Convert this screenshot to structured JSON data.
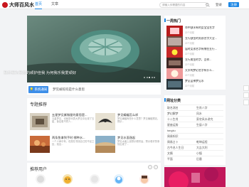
{
  "header": {
    "logo_text": "大师百风水",
    "nav": [
      {
        "label": "首页"
      },
      {
        "label": "文章"
      }
    ],
    "search_placeholder": "请输入你需要的内容",
    "login_link": "登录",
    "register_button": "注册"
  },
  "banner": {
    "caption": "我乐我为我爱的顽护佳我 为何我乐我爱顽好"
  },
  "notice": {
    "tag": "💡 系统通知",
    "text": "梦见被蛇咬是什么意思"
  },
  "recommended": {
    "title": "专题推荐",
    "items": [
      {
        "title": "五星梦见紫微星的意思是...",
        "desc": "五星梦见，也就是代表大梦见中出现了五星，象征着不同人..."
      },
      {
        "title": "梦见蝙蝠怎么样",
        "desc": "梦见蝙蝠有些什么意思？梦见蝙蝠预兆，预示..."
      },
      {
        "title": "两条鱼拿到手时 哪种水...",
        "desc": "一个人命中有，但是在寻找自己的不足之处，找出..."
      },
      {
        "title": "梦见水面涨起",
        "desc": "梦见水面上涨预示着财运，预示着好的事情出现了..."
      }
    ]
  },
  "users": {
    "title": "推荐用户",
    "prev_icon": "chevron-left",
    "next_icon": "chevron-right"
  },
  "hot": {
    "title": "一周热门",
    "items": [
      {
        "title": "命中缺水有的女宝宝名字",
        "meta": "22个月前"
      },
      {
        "title": "五行缺金的男孩名字大全...",
        "meta": "22个月前"
      },
      {
        "title": "届时女孩名字有哪些五行...",
        "meta": "22个月前"
      },
      {
        "title": "五行属金的字，吉祥...",
        "meta": "22个月前"
      },
      {
        "title": "太学的梦幻名字有什么...",
        "meta": "22个月前"
      },
      {
        "title": "梦见蓝神梦见水",
        "meta": "22个月前"
      }
    ]
  },
  "categories": {
    "title": "网址分类",
    "items": [
      "取名测名",
      "生肖八字",
      "梦幻解梦",
      "风水",
      "十二生肖",
      "家宅风水讲究",
      "星座运势",
      "生辰八字",
      "tangku",
      "",
      "周易知识",
      "",
      "周易占卜",
      "乾坤运程",
      "古今名人生日",
      "大吉大利",
      "文摘",
      "小镇",
      "平面",
      "后盾"
    ]
  },
  "colors": {
    "accent": "#1e88e5",
    "logo": "#c8161d",
    "notice_tag": "#3d8ee8"
  }
}
